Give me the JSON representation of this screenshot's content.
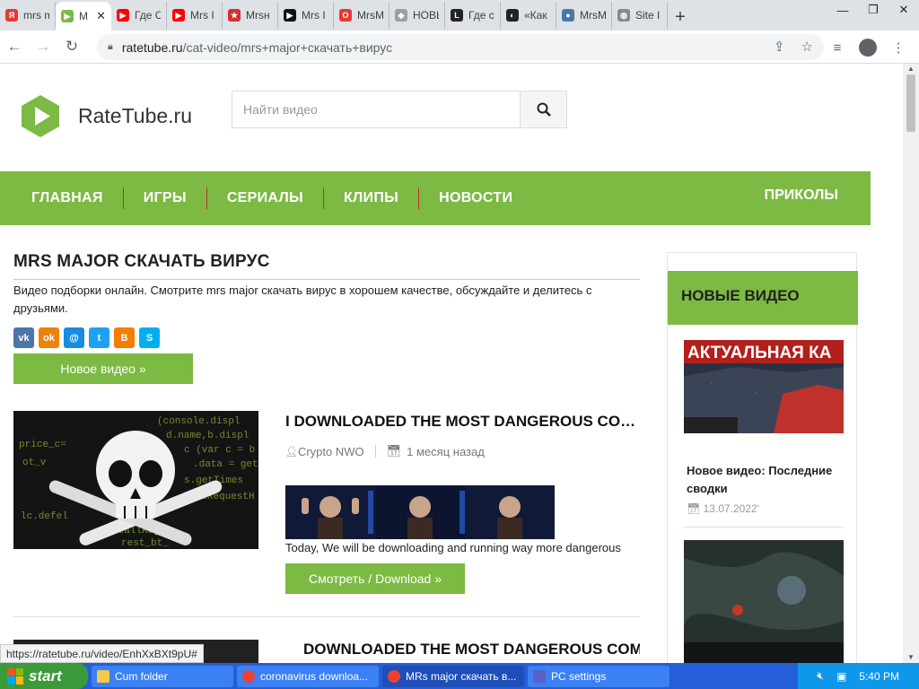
{
  "browser": {
    "tabs": [
      {
        "title": "mrs m",
        "color": "#e53935",
        "glyph": "Я"
      },
      {
        "title": "M",
        "color": "#7cba43",
        "glyph": "▶",
        "active": true
      },
      {
        "title": "Где С",
        "color": "#ff0000",
        "glyph": "▶"
      },
      {
        "title": "Mrs I",
        "color": "#ff0000",
        "glyph": "▶"
      },
      {
        "title": "Mrsн",
        "color": "#d32f2f",
        "glyph": "★"
      },
      {
        "title": "Mrs I",
        "color": "#111111",
        "glyph": "▶"
      },
      {
        "title": "MrsM",
        "color": "#e53935",
        "glyph": "O"
      },
      {
        "title": "НОВЬ",
        "color": "#9e9e9e",
        "glyph": "◆"
      },
      {
        "title": "Где с",
        "color": "#222222",
        "glyph": "L"
      },
      {
        "title": "«Как",
        "color": "#222222",
        "glyph": "◐"
      },
      {
        "title": "MrsM",
        "color": "#4a76a8",
        "glyph": "●"
      },
      {
        "title": "Site I",
        "color": "#888888",
        "glyph": "◍"
      }
    ],
    "url_host": "ratetube.ru",
    "url_path": "/cat-video/mrs+major+скачать+вирус",
    "status_url": "https://ratetube.ru/video/EnhXxBXt9pU#"
  },
  "site": {
    "logo_text": "RateTube.ru",
    "search_placeholder": "Найти видео",
    "menu": [
      "ГЛАВНАЯ",
      "ИГРЫ",
      "СЕРИАЛЫ",
      "КЛИПЫ",
      "НОВОСТИ"
    ],
    "menu_right": "ПРИКОЛЫ",
    "accent": "#7cba43"
  },
  "main": {
    "heading": "MRS MAJOR СКАЧАТЬ ВИРУС",
    "description": "Видео подборки онлайн. Смотрите mrs major скачать вирус в хорошем качестве, обсуждайте и делитесь с друзьями.",
    "new_video_button": "Новое видео »",
    "card": {
      "title": "I DOWNLOADED THE MOST DANGEROUS COM...",
      "author": "Crypto NWO",
      "date": "1 месяц назад",
      "excerpt": "Today, We will be downloading and running way more dangerous",
      "watch_button": "Смотреть / Download  »"
    },
    "card2_title": "DOWNLOADED THE MOST DANGEROUS COM..."
  },
  "sidebar": {
    "heading": "НОВЫЕ ВИДЕО",
    "thumb1_caption": "АКТУАЛЬНАЯ КА",
    "item1_title": "Новое видео: Последние сводки",
    "item1_date": "13.07.2022'"
  },
  "taskbar": {
    "start_label": "start",
    "tasks": [
      "Cum folder",
      "coronavirus downloa...",
      "MRs major скачать в...",
      "PC settings"
    ],
    "clock": "5:40 PM"
  }
}
